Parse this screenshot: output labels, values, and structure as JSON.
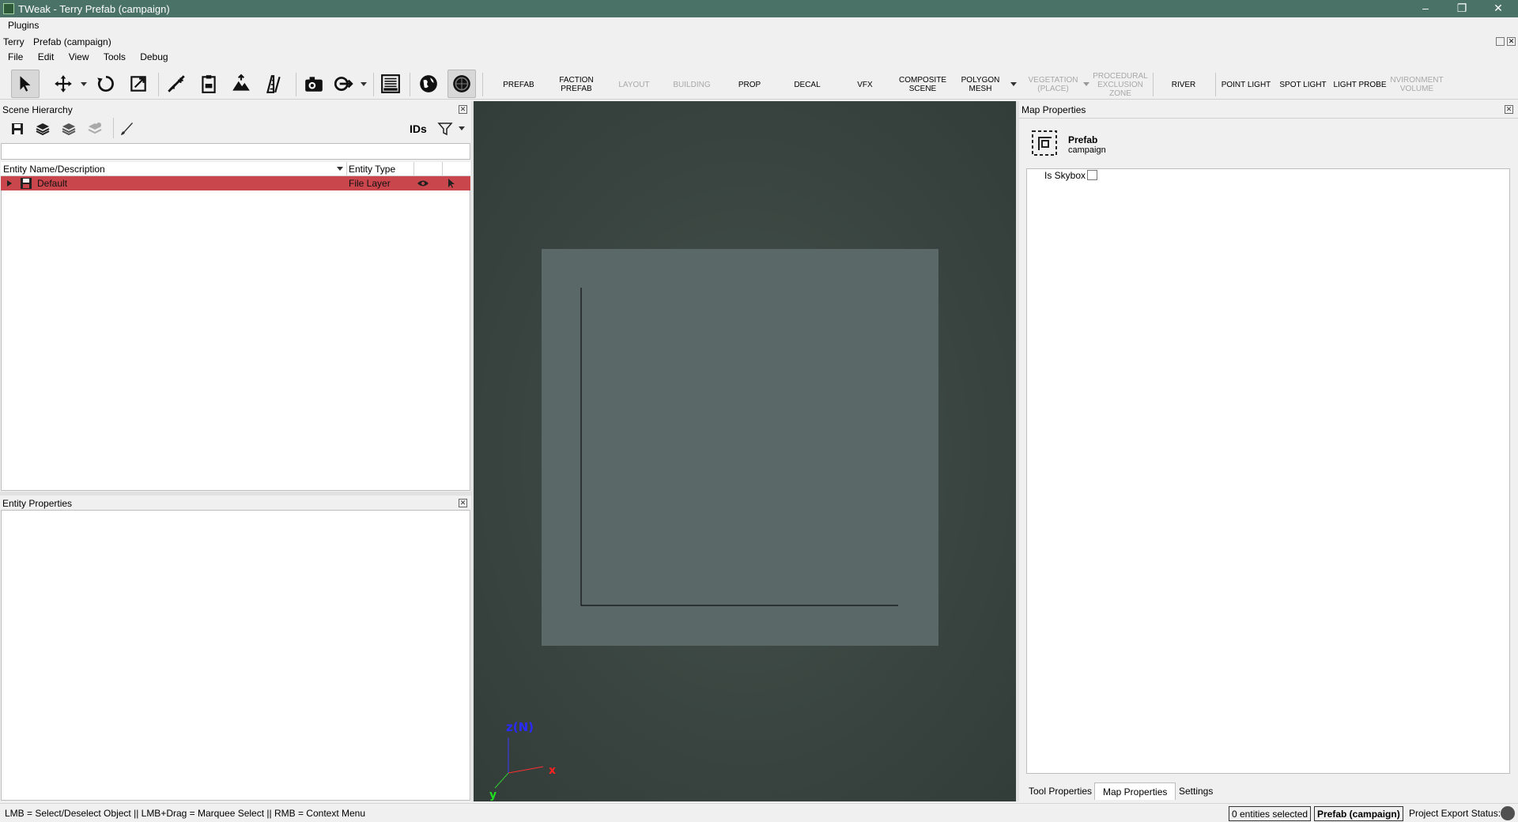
{
  "window": {
    "title": "TWeak - Terry   Prefab (campaign)",
    "minimize": "–",
    "restore": "❐",
    "close": "✕"
  },
  "menubar1": {
    "items": [
      "Plugins"
    ]
  },
  "menubar2": {
    "items": [
      "Terry",
      "Prefab (campaign)"
    ]
  },
  "menubar3": {
    "items": [
      "File",
      "Edit",
      "View",
      "Tools",
      "Debug"
    ]
  },
  "toolbar": {
    "entity_tools": [
      {
        "label": "PREFAB",
        "enabled": true
      },
      {
        "label": "FACTION PREFAB",
        "enabled": true
      },
      {
        "label": "LAYOUT",
        "enabled": false
      },
      {
        "label": "BUILDING",
        "enabled": false
      },
      {
        "label": "PROP",
        "enabled": true
      },
      {
        "label": "DECAL",
        "enabled": true
      },
      {
        "label": "VFX",
        "enabled": true
      },
      {
        "label": "COMPOSITE SCENE",
        "enabled": true
      },
      {
        "label": "POLYGON MESH",
        "enabled": true
      },
      {
        "label": "VEGETATION (PLACE)",
        "enabled": false
      },
      {
        "label": "PROCEDURAL EXCLUSION ZONE",
        "enabled": false
      },
      {
        "label": "RIVER",
        "enabled": true
      },
      {
        "label": "POINT LIGHT",
        "enabled": true
      },
      {
        "label": "SPOT LIGHT",
        "enabled": true
      },
      {
        "label": "LIGHT PROBE",
        "enabled": true
      },
      {
        "label": "NVIRONMENT VOLUME",
        "enabled": false
      }
    ]
  },
  "scene_hierarchy": {
    "title": "Scene Hierarchy",
    "ids_label": "IDs",
    "filter_value": "",
    "columns": [
      "Entity Name/Description",
      "Entity Type"
    ],
    "rows": [
      {
        "name": "Default",
        "type": "File Layer",
        "selected": true
      }
    ]
  },
  "entity_properties": {
    "title": "Entity Properties"
  },
  "viewport": {
    "axis_z": "z(N)",
    "axis_x": "x",
    "axis_y": "y"
  },
  "map_properties": {
    "title": "Map Properties",
    "entity_type": "Prefab",
    "entity_name": "campaign",
    "is_skybox_label": "Is Skybox",
    "is_skybox": false,
    "tabs": [
      {
        "label": "Tool Properties",
        "active": false
      },
      {
        "label": "Map Properties",
        "active": true
      },
      {
        "label": "Settings",
        "active": false
      }
    ]
  },
  "statusbar": {
    "hint": "LMB = Select/Deselect Object || LMB+Drag = Marquee Select || RMB = Context Menu",
    "selection_count": "0 entities selected",
    "document": "Prefab (campaign)",
    "export_label": "Project Export Status:"
  },
  "colors": {
    "titlebar": "#4a7266",
    "selected_row": "#c9464c",
    "viewport_bg": "#3a4541",
    "plane": "#5a6968",
    "axis_z": "#2a2aff",
    "axis_x": "#ff2a2a",
    "axis_y": "#2aff2a"
  }
}
